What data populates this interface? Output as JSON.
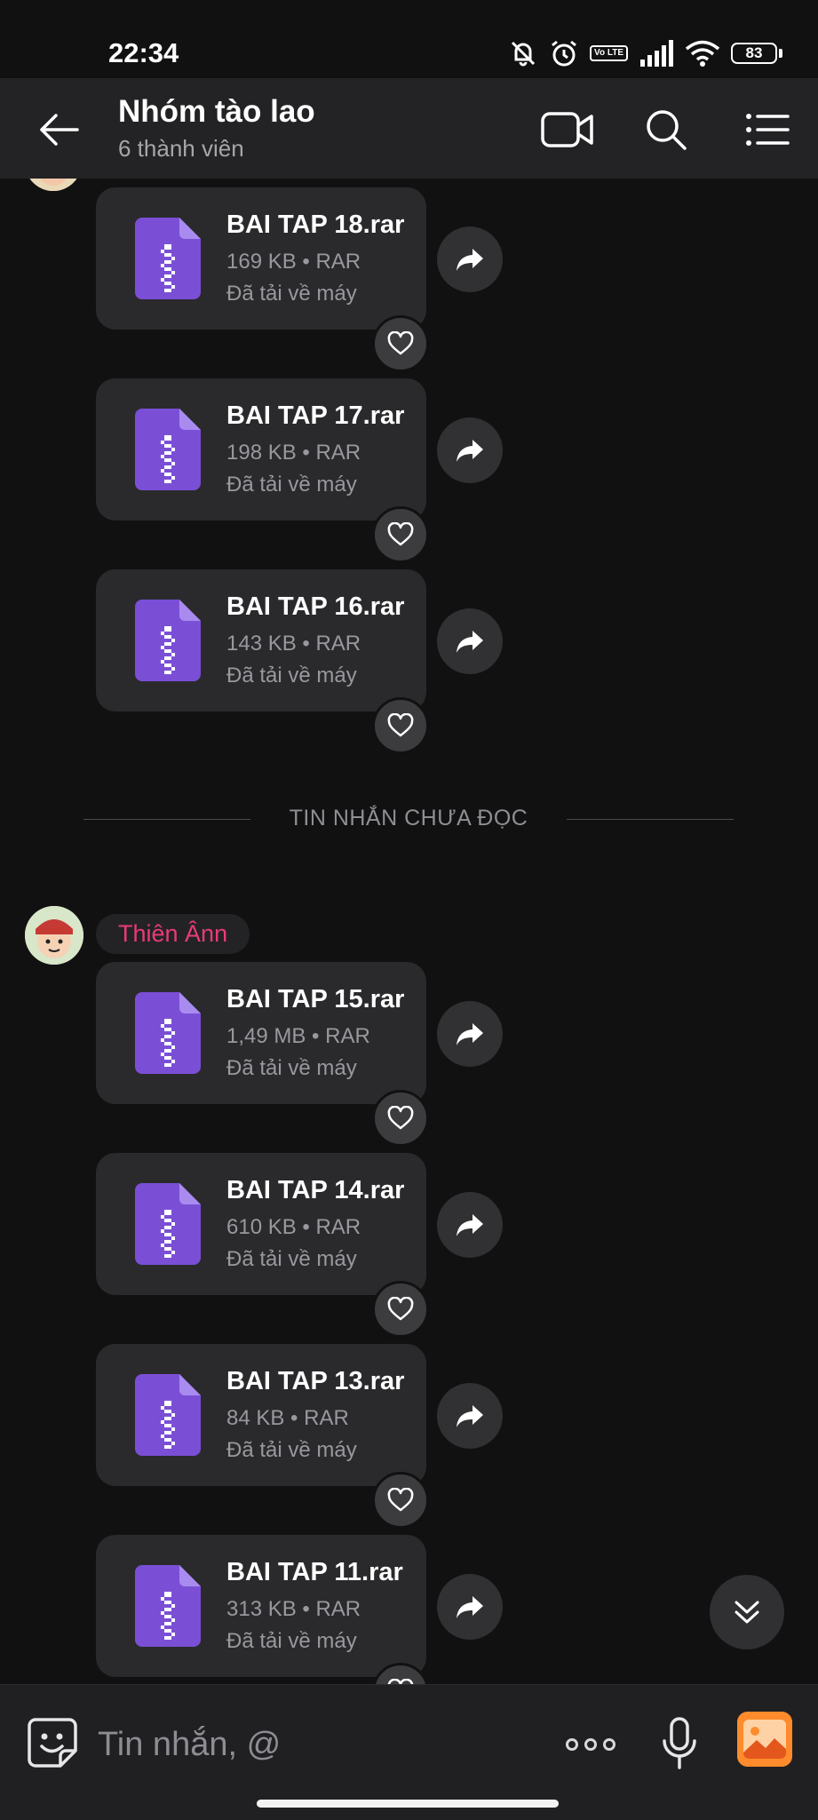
{
  "status_bar": {
    "time": "22:34",
    "battery": "83",
    "network_badge": "Vo LTE"
  },
  "header": {
    "title": "Nhóm tào lao",
    "subtitle": "6 thành viên"
  },
  "divider": {
    "label": "TIN NHẮN CHƯA ĐỌC"
  },
  "sender": {
    "name": "Thiên Ânn"
  },
  "messages_before": [
    {
      "name": "BAI TAP 18.rar",
      "meta": "169 KB • RAR",
      "status": "Đã tải về máy"
    },
    {
      "name": "BAI TAP 17.rar",
      "meta": "198 KB • RAR",
      "status": "Đã tải về máy"
    },
    {
      "name": "BAI TAP 16.rar",
      "meta": "143 KB • RAR",
      "status": "Đã tải về máy"
    }
  ],
  "messages_after": [
    {
      "name": "BAI TAP 15.rar",
      "meta": "1,49 MB • RAR",
      "status": "Đã tải về máy"
    },
    {
      "name": "BAI TAP 14.rar",
      "meta": "610 KB • RAR",
      "status": "Đã tải về máy"
    },
    {
      "name": "BAI TAP 13.rar",
      "meta": "84 KB • RAR",
      "status": "Đã tải về máy"
    },
    {
      "name": "BAI TAP 11.rar",
      "meta": "313 KB • RAR",
      "status": "Đã tải về máy"
    }
  ],
  "composer": {
    "placeholder": "Tin nhắn, @"
  },
  "colors": {
    "zip_icon": "#7a4fd6",
    "sender_name": "#ea3a78",
    "image_button": "#ff8b2c",
    "background": "#111112"
  },
  "icons": [
    "back-arrow-icon",
    "video-call-icon",
    "search-icon",
    "menu-list-icon",
    "zip-file-icon",
    "forward-icon",
    "heart-icon",
    "scroll-down-icon",
    "sticker-icon",
    "more-icon",
    "microphone-icon",
    "image-icon"
  ]
}
